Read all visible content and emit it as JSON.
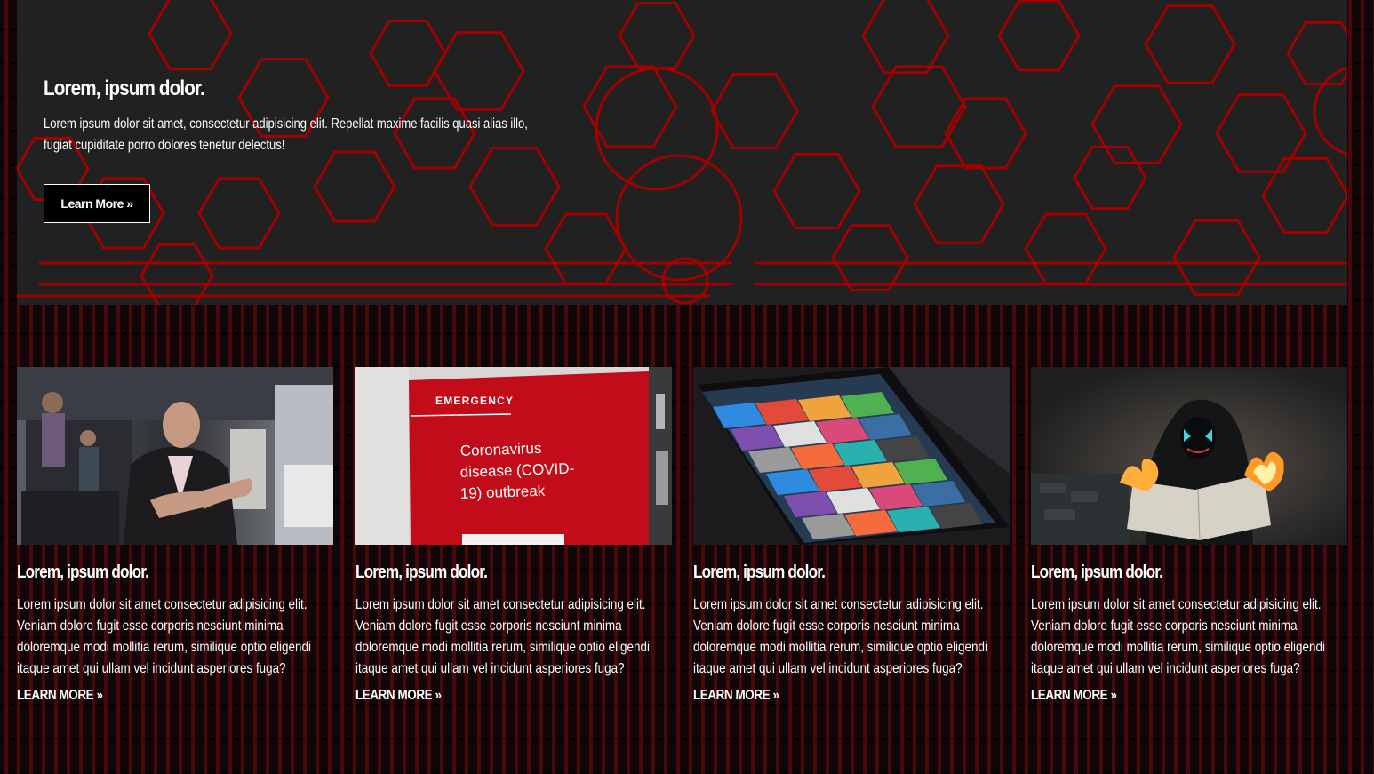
{
  "hero": {
    "title": "Lorem, ipsum dolor.",
    "description": "Lorem ipsum dolor sit amet, consectetur adipisicing elit. Repellat maxime facilis quasi alias illo, fugiat cupiditate porro dolores tenetur delectus!",
    "button_label": "Learn More »",
    "accent_color": "#b00000",
    "background_color": "#222122"
  },
  "cards": [
    {
      "image": "news-presenter-photo",
      "title": "Lorem, ipsum dolor.",
      "text": "Lorem ipsum dolor sit amet consectetur adipisicing elit. Veniam dolore fugit esse corporis nesciunt minima doloremque modi mollitia rerum, similique optio eligendi itaque amet qui ullam vel incidunt asperiores fuga?",
      "link_label": "LEARN MORE »"
    },
    {
      "image": "coronavirus-emergency-sign-photo",
      "title": "Lorem, ipsum dolor.",
      "text": "Lorem ipsum dolor sit amet consectetur adipisicing elit. Veniam dolore fugit esse corporis nesciunt minima doloremque modi mollitia rerum, similique optio eligendi itaque amet qui ullam vel incidunt asperiores fuga?",
      "link_label": "LEARN MORE »",
      "image_texts": {
        "sign_header": "EMERGENCY",
        "sign_body": "Coronavirus disease (COVID-19) outbreak"
      }
    },
    {
      "image": "tablet-app-photo",
      "title": "Lorem, ipsum dolor.",
      "text": "Lorem ipsum dolor sit amet consectetur adipisicing elit. Veniam dolore fugit esse corporis nesciunt minima doloremque modi mollitia rerum, similique optio eligendi itaque amet qui ullam vel incidunt asperiores fuga?",
      "link_label": "LEARN MORE »"
    },
    {
      "image": "hooded-figure-burning-newspaper-photo",
      "title": "Lorem, ipsum dolor.",
      "text": "Lorem ipsum dolor sit amet consectetur adipisicing elit. Veniam dolore fugit esse corporis nesciunt minima doloremque modi mollitia rerum, similique optio eligendi itaque amet qui ullam vel incidunt asperiores fuga?",
      "link_label": "LEARN MORE »"
    }
  ]
}
